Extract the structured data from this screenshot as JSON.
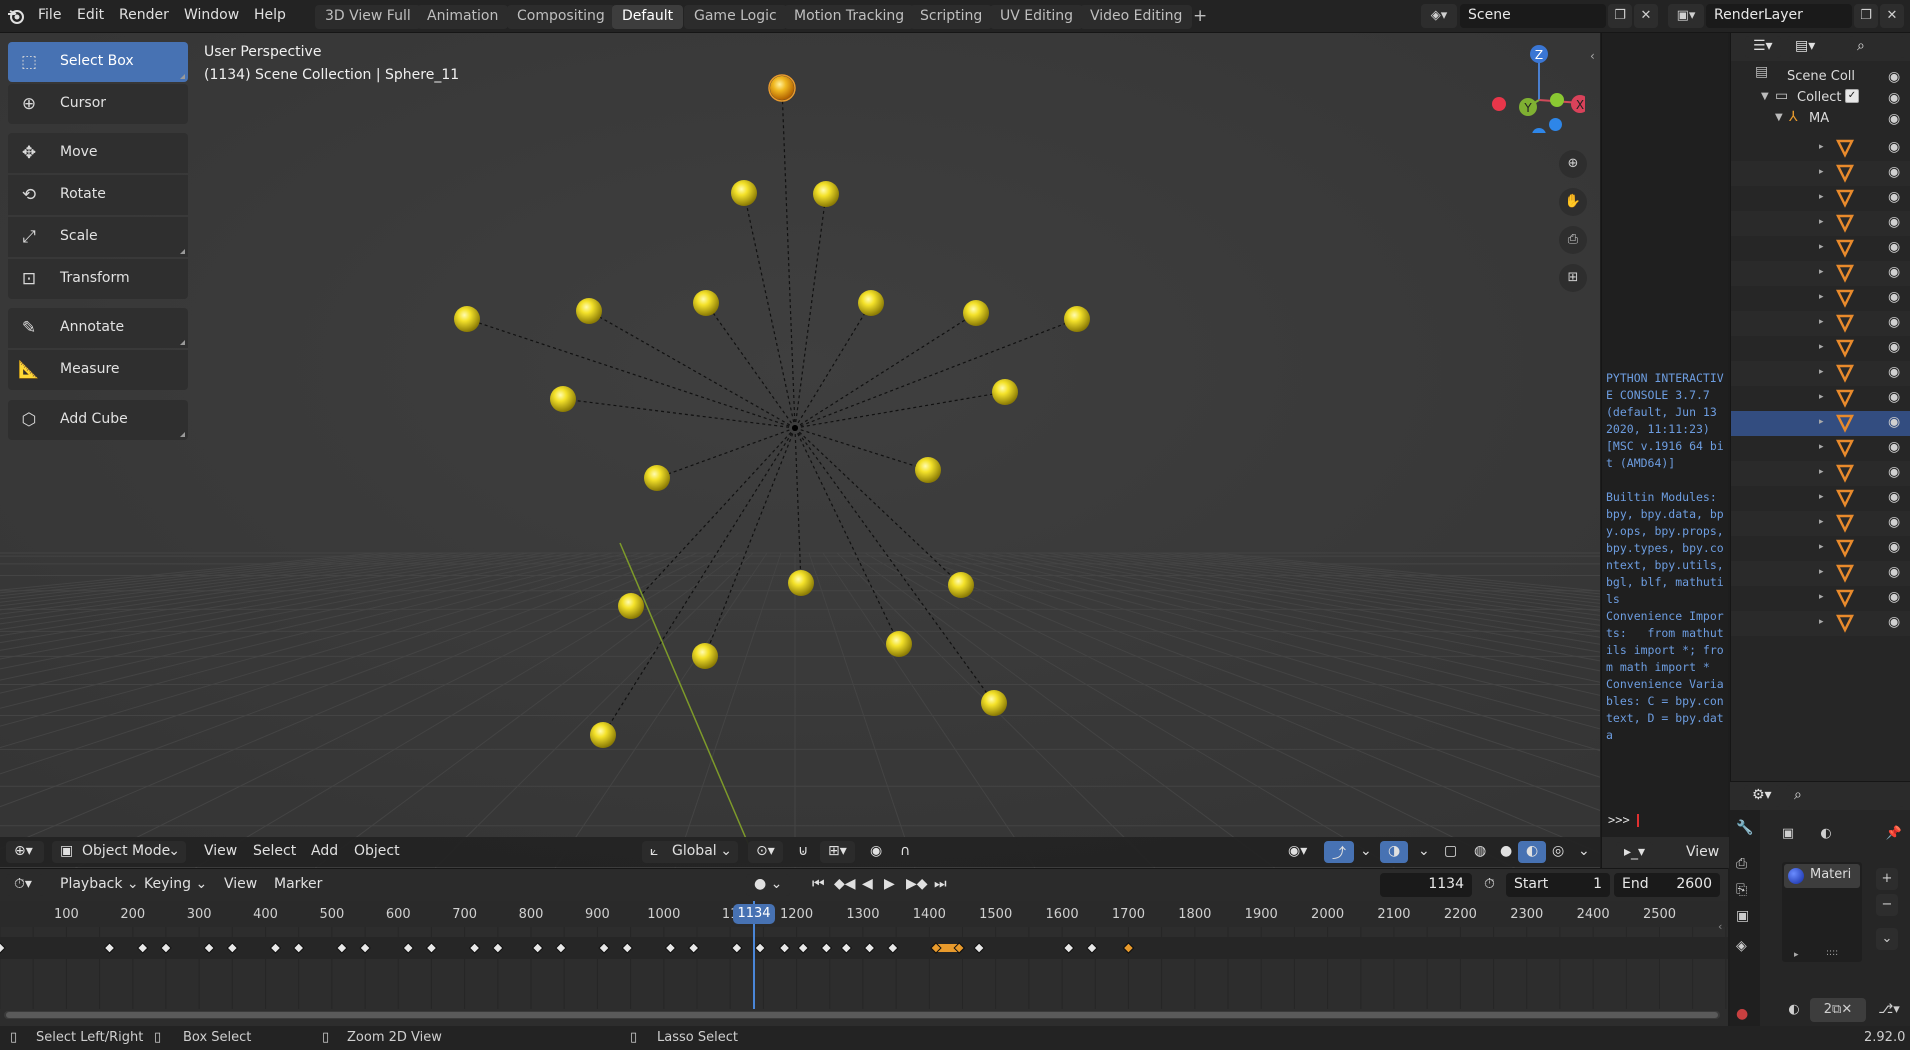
{
  "topbar": {
    "menus": [
      "File",
      "Edit",
      "Render",
      "Window",
      "Help"
    ],
    "workspaces": [
      "3D View Full",
      "Animation",
      "Compositing",
      "Default",
      "Game Logic",
      "Motion Tracking",
      "Scripting",
      "UV Editing",
      "Video Editing"
    ],
    "active_workspace": "Default",
    "add_workspace": "+",
    "scene_name": "Scene",
    "view_layer_name": "RenderLayer"
  },
  "toolbar": {
    "tools": [
      {
        "label": "Select Box",
        "icon": "select-box-icon",
        "selected": true
      },
      {
        "label": "Cursor",
        "icon": "cursor-icon",
        "selected": false
      },
      {
        "label": "Move",
        "icon": "move-icon",
        "selected": false
      },
      {
        "label": "Rotate",
        "icon": "rotate-icon",
        "selected": false
      },
      {
        "label": "Scale",
        "icon": "scale-icon",
        "selected": false
      },
      {
        "label": "Transform",
        "icon": "transform-icon",
        "selected": false
      },
      {
        "label": "Annotate",
        "icon": "annotate-icon",
        "selected": false
      },
      {
        "label": "Measure",
        "icon": "measure-icon",
        "selected": false
      },
      {
        "label": "Add Cube",
        "icon": "add-cube-icon",
        "selected": false
      }
    ]
  },
  "viewport": {
    "perspective_label": "User Perspective",
    "context_label": "(1134) Scene Collection | Sphere_11",
    "gizmo": {
      "z": "Z",
      "y": "Y",
      "x": "X"
    },
    "header": {
      "mode": "Object Mode",
      "menus": [
        "View",
        "Select",
        "Add",
        "Object"
      ],
      "orientation": "Global"
    }
  },
  "console": {
    "text": "PYTHON INTERACTIVE CONSOLE 3.7.7 (default, Jun 13 2020, 11:11:23) [MSC v.1916 64 bit (AMD64)]\n\nBuiltin Modules:       bpy, bpy.data, bpy.ops, bpy.props, bpy.types, bpy.context, bpy.utils, bgl, blf, mathutils\nConvenience Imports:   from mathutils import *; from math import *\nConvenience Variables: C = bpy.context, D = bpy.data",
    "prompt": ">>> ",
    "header_menu": "View"
  },
  "outliner": {
    "scene_collection": "Scene Coll",
    "collection": "Collect",
    "armature": "MA",
    "object_rows": 20,
    "selected_row": 11
  },
  "properties": {
    "material_slot": "Materi"
  },
  "timeline": {
    "header": {
      "menus": [
        "Playback",
        "Keying",
        "View",
        "Marker"
      ],
      "current_frame": "1134",
      "start_label": "Start",
      "start_value": "1",
      "end_label": "End",
      "end_value": "2600"
    },
    "ruler_labels": [
      "100",
      "200",
      "300",
      "400",
      "500",
      "600",
      "700",
      "800",
      "900",
      "1000",
      "11",
      "1200",
      "1300",
      "1400",
      "1500",
      "1600",
      "1700",
      "1800",
      "1900",
      "2000",
      "2100",
      "2200",
      "2300",
      "2400",
      "2500"
    ],
    "playhead_frame": "1134"
  },
  "statusbar": {
    "items": [
      "Select Left/Right",
      "Box Select",
      "Zoom 2D View",
      "Lasso Select"
    ],
    "version": "2.92.0"
  },
  "colors": {
    "accent": "#4772b3",
    "sphere": "#e6d21c",
    "keyframe": "#e8e8e8",
    "keyframe_selected": "#e89a2c",
    "console_text": "#6d9de0"
  }
}
